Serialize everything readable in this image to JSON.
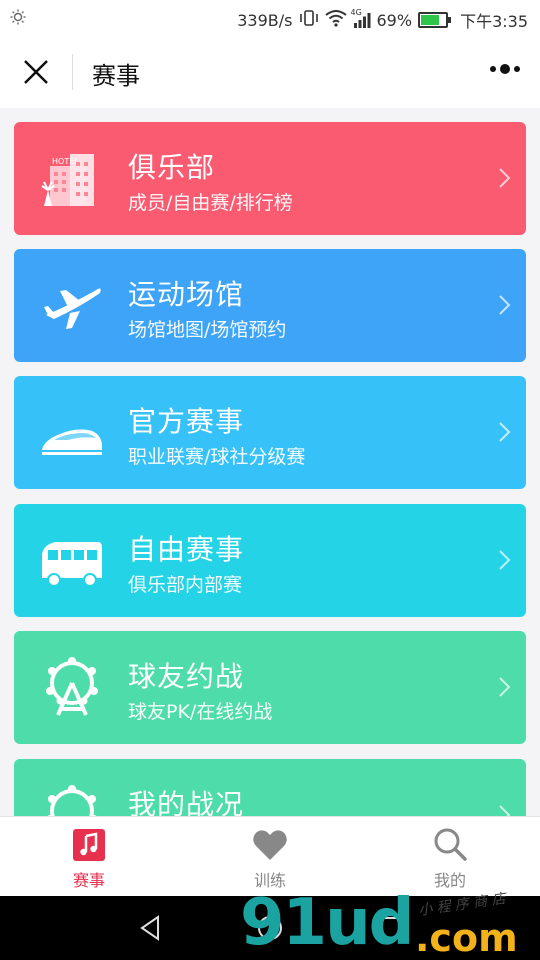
{
  "status_bar": {
    "speed": "339B/s",
    "network": "4G",
    "battery": "69%",
    "time": "下午3:35"
  },
  "nav": {
    "title": "赛事"
  },
  "cards": [
    {
      "title": "俱乐部",
      "subtitle": "成员/自由赛/排行榜",
      "color": "#fb5b71",
      "icon": "hotel-icon"
    },
    {
      "title": "运动场馆",
      "subtitle": "场馆地图/场馆预约",
      "color": "#3ea4f8",
      "icon": "airplane-icon"
    },
    {
      "title": "官方赛事",
      "subtitle": "职业联赛/球社分级赛",
      "color": "#36c2f8",
      "icon": "bullet-train-icon"
    },
    {
      "title": "自由赛事",
      "subtitle": "俱乐部内部赛",
      "color": "#24d4e6",
      "icon": "bus-icon"
    },
    {
      "title": "球友约战",
      "subtitle": "球友PK/在线约战",
      "color": "#4ddcaa",
      "icon": "ferris-wheel-icon"
    },
    {
      "title": "我的战况",
      "subtitle": "",
      "color": "#4ddcaa",
      "icon": "ferris-wheel-icon"
    }
  ],
  "tabs": [
    {
      "label": "赛事",
      "icon": "music-note-icon",
      "active": true
    },
    {
      "label": "训练",
      "icon": "heart-icon",
      "active": false
    },
    {
      "label": "我的",
      "icon": "search-icon",
      "active": false
    }
  ],
  "watermark": {
    "main": "91ud",
    "domain": ".com",
    "tagline": "小 程 序 商 店"
  },
  "colors": {
    "accent": "#e6304d",
    "inactive": "#888888"
  }
}
